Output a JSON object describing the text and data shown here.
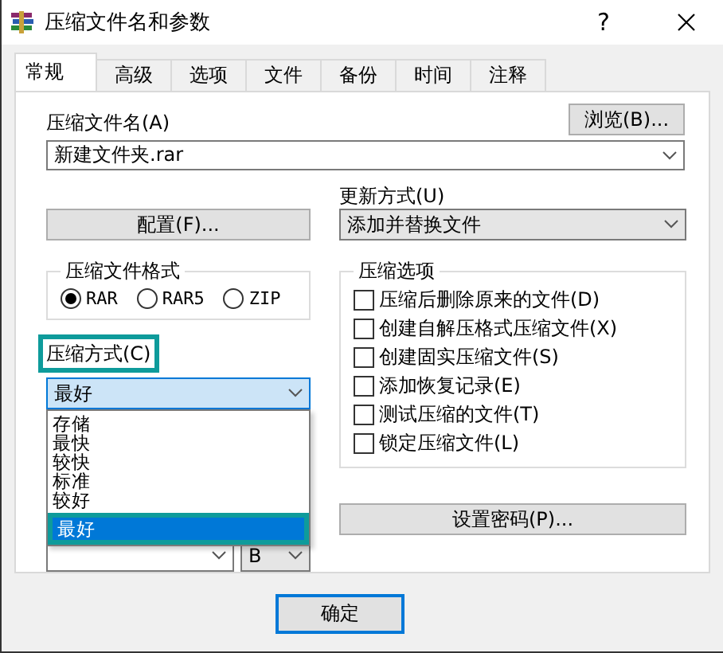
{
  "window": {
    "title": "压缩文件名和参数",
    "help": "?"
  },
  "tabs": [
    {
      "label": "常规",
      "selected": true
    },
    {
      "label": "高级",
      "selected": false
    },
    {
      "label": "选项",
      "selected": false
    },
    {
      "label": "文件",
      "selected": false
    },
    {
      "label": "备份",
      "selected": false
    },
    {
      "label": "时间",
      "selected": false
    },
    {
      "label": "注释",
      "selected": false
    }
  ],
  "archive_name": {
    "label": "压缩文件名(A)",
    "value": "新建文件夹.rar",
    "browse_button": "浏览(B)..."
  },
  "profiles_button": "配置(F)...",
  "update_mode": {
    "label": "更新方式(U)",
    "value": "添加并替换文件"
  },
  "archive_format": {
    "title": "压缩文件格式",
    "options": [
      {
        "label": "RAR",
        "selected": true
      },
      {
        "label": "RAR5",
        "selected": false
      },
      {
        "label": "ZIP",
        "selected": false
      }
    ]
  },
  "compression_method": {
    "label": "压缩方式(C)",
    "label_highlighted": true,
    "value": "最好",
    "expanded": true,
    "options": [
      {
        "label": "存储",
        "selected": false,
        "highlighted": false
      },
      {
        "label": "最快",
        "selected": false,
        "highlighted": false
      },
      {
        "label": "较快",
        "selected": false,
        "highlighted": false
      },
      {
        "label": "标准",
        "selected": false,
        "highlighted": false
      },
      {
        "label": "较好",
        "selected": false,
        "highlighted": false
      },
      {
        "label": "最好",
        "selected": true,
        "highlighted": true
      }
    ]
  },
  "size_unit": {
    "value": "B"
  },
  "archive_options": {
    "title": "压缩选项",
    "items": [
      {
        "label": "压缩后删除原来的文件(D)",
        "checked": false
      },
      {
        "label": "创建自解压格式压缩文件(X)",
        "checked": false
      },
      {
        "label": "创建固实压缩文件(S)",
        "checked": false
      },
      {
        "label": "添加恢复记录(E)",
        "checked": false
      },
      {
        "label": "测试压缩的文件(T)",
        "checked": false
      },
      {
        "label": "锁定压缩文件(L)",
        "checked": false
      }
    ]
  },
  "set_password_button": "设置密码(P)...",
  "buttons": [
    {
      "label": "确定",
      "default": true
    }
  ]
}
